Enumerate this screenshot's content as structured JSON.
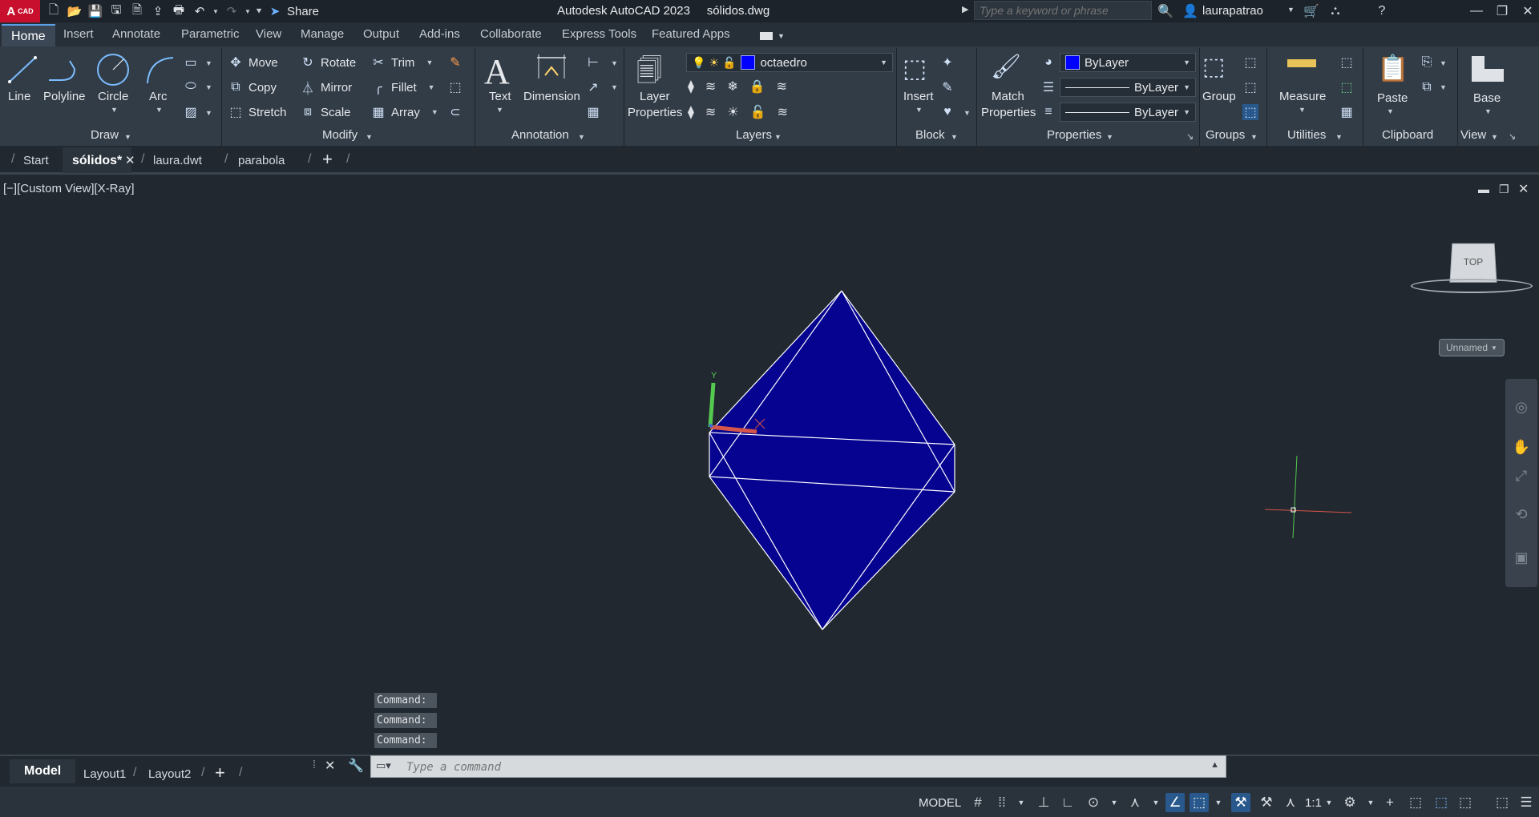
{
  "app": {
    "logo_text": "A",
    "logo_sub": "CAD",
    "title": "Autodesk AutoCAD 2023     sólidos.dwg",
    "share_label": "Share",
    "search_placeholder": "Type a keyword or phrase",
    "user": "laurapatrao"
  },
  "ribbon_tabs": [
    "Home",
    "Insert",
    "Annotate",
    "Parametric",
    "View",
    "Manage",
    "Output",
    "Add-ins",
    "Collaborate",
    "Express Tools",
    "Featured Apps"
  ],
  "draw_panel": {
    "line": "Line",
    "polyline": "Polyline",
    "circle": "Circle",
    "arc": "Arc",
    "title": "Draw"
  },
  "modify_panel": {
    "move": "Move",
    "rotate": "Rotate",
    "trim": "Trim",
    "copy": "Copy",
    "mirror": "Mirror",
    "fillet": "Fillet",
    "stretch": "Stretch",
    "scale": "Scale",
    "array": "Array",
    "title": "Modify"
  },
  "annotation_panel": {
    "text": "Text",
    "dimension": "Dimension",
    "title": "Annotation"
  },
  "layers_panel": {
    "layer_properties_1": "Layer",
    "layer_properties_2": "Properties",
    "current_layer": "octaedro",
    "title": "Layers"
  },
  "block_panel": {
    "insert": "Insert",
    "title": "Block"
  },
  "properties_panel": {
    "match_1": "Match",
    "match_2": "Properties",
    "color": "ByLayer",
    "lineweight": "ByLayer",
    "linetype": "ByLayer",
    "title": "Properties"
  },
  "groups_panel": {
    "group": "Group",
    "title": "Groups"
  },
  "utilities_panel": {
    "measure": "Measure",
    "title": "Utilities"
  },
  "clipboard_panel": {
    "paste": "Paste",
    "title": "Clipboard"
  },
  "view_panel": {
    "base": "Base",
    "title": "View"
  },
  "file_tabs": {
    "start": "Start",
    "active": "sólidos*",
    "tab2": "laura.dwt",
    "tab3": "parabola"
  },
  "viewport": {
    "label": "[−][Custom View][X-Ray]",
    "viewcube_face": "TOP",
    "ucs_name": "Unnamed",
    "octahedron_fill": "#05038f",
    "edge_color": "#ffffff"
  },
  "command_history": [
    "Command:",
    "Command:",
    "Command:"
  ],
  "command_placeholder": "Type a command",
  "layout_tabs": [
    "Model",
    "Layout1",
    "Layout2"
  ],
  "status": {
    "model": "MODEL",
    "scale": "1:1"
  }
}
